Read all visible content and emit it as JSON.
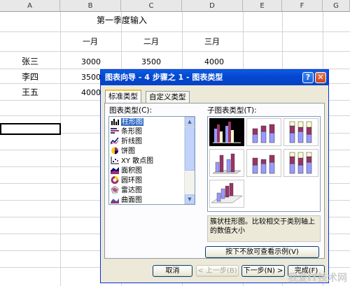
{
  "sheet": {
    "columns": [
      "A",
      "B",
      "C",
      "D",
      "E",
      "F",
      "G"
    ],
    "title": "第一季度输入",
    "months": [
      "一月",
      "二月",
      "三月"
    ],
    "names": [
      "张三",
      "李四",
      "王五"
    ],
    "values": [
      [
        "3000",
        "3500",
        "4000"
      ],
      [
        "3500"
      ],
      [
        "4000"
      ]
    ]
  },
  "dialog": {
    "title": "图表向导 - 4 步骤之 1 - 图表类型",
    "help": "?",
    "close": "✕",
    "tabs": [
      "标准类型",
      "自定义类型"
    ],
    "chart_type_label": "图表类型(C):",
    "subtype_label": "子图表类型(T):",
    "chart_types": [
      "柱形图",
      "条形图",
      "折线图",
      "饼图",
      "XY 散点图",
      "面积图",
      "圆环图",
      "雷达图",
      "曲面图"
    ],
    "selected_type": "柱形图",
    "description": "簇状柱形图。比较相交于类别轴上的数值大小",
    "preview_button": "按下不放可查看示例(V)",
    "buttons": {
      "cancel": "取消",
      "back": "< 上一步(B)",
      "next": "下一步(N) >",
      "finish": "完成(F)"
    },
    "colors": {
      "title_bar": "#0548cf",
      "selection": "#316ac5",
      "bar_blue": "#9999ff",
      "bar_purple": "#993366",
      "bar_cream": "#ffffcc"
    }
  },
  "watermark": "我爱IT技术网"
}
